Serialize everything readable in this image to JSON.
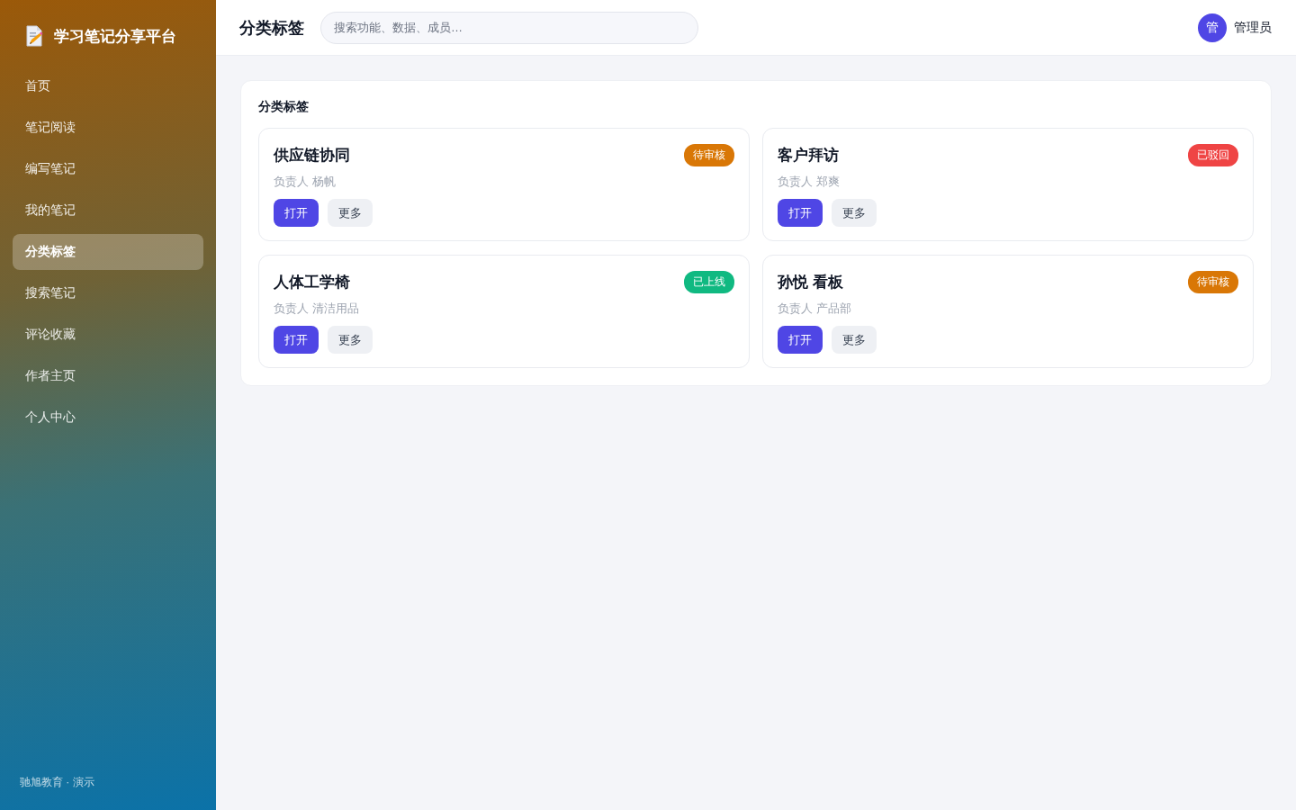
{
  "sidebar": {
    "brand": "学习笔记分享平台",
    "items": [
      {
        "label": "首页",
        "selected": false
      },
      {
        "label": "笔记阅读",
        "selected": false
      },
      {
        "label": "编写笔记",
        "selected": false
      },
      {
        "label": "我的笔记",
        "selected": false
      },
      {
        "label": "分类标签",
        "selected": true
      },
      {
        "label": "搜索笔记",
        "selected": false
      },
      {
        "label": "评论收藏",
        "selected": false
      },
      {
        "label": "作者主页",
        "selected": false
      },
      {
        "label": "个人中心",
        "selected": false
      }
    ],
    "footer": "驰旭教育 · 演示"
  },
  "header": {
    "title": "分类标签",
    "search": {
      "placeholder": "搜索功能、数据、成员…"
    },
    "user": {
      "avatar": "管",
      "name": "管理员"
    }
  },
  "panel": {
    "title": "分类标签",
    "cards": [
      {
        "title": "供应链协同",
        "badge": {
          "label": "待审核",
          "color": "#d97706"
        },
        "owner": "负责人 杨帆",
        "buttons": [
          {
            "label": "打开",
            "kind": "primary"
          },
          {
            "label": "更多",
            "kind": "secondary"
          }
        ]
      },
      {
        "title": "客户拜访",
        "badge": {
          "label": "已驳回",
          "color": "#ef4444"
        },
        "owner": "负责人 郑爽",
        "buttons": [
          {
            "label": "打开",
            "kind": "primary"
          },
          {
            "label": "更多",
            "kind": "secondary"
          }
        ]
      },
      {
        "title": "人体工学椅",
        "badge": {
          "label": "已上线",
          "color": "#10b981"
        },
        "owner": "负责人 清洁用品",
        "buttons": [
          {
            "label": "打开",
            "kind": "primary"
          },
          {
            "label": "更多",
            "kind": "secondary"
          }
        ]
      },
      {
        "title": "孙悦 看板",
        "badge": {
          "label": "待审核",
          "color": "#d97706"
        },
        "owner": "负责人 产品部",
        "buttons": [
          {
            "label": "打开",
            "kind": "primary"
          },
          {
            "label": "更多",
            "kind": "secondary"
          }
        ]
      }
    ]
  }
}
